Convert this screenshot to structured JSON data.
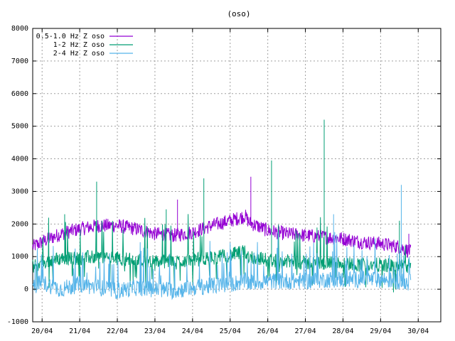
{
  "chart_data": {
    "type": "line",
    "title": "(oso)",
    "xlabel": "",
    "ylabel": "",
    "ylim": [
      -1000,
      8000
    ],
    "yticks": [
      "-1000",
      "0",
      "1000",
      "2000",
      "3000",
      "4000",
      "5000",
      "6000",
      "7000",
      "8000"
    ],
    "xlim": [
      0,
      10.6
    ],
    "xticks": [
      {
        "x": 0,
        "label": "20/04"
      },
      {
        "x": 1,
        "label": "21/04"
      },
      {
        "x": 2,
        "label": "22/04"
      },
      {
        "x": 3,
        "label": "23/04"
      },
      {
        "x": 4,
        "label": "24/04"
      },
      {
        "x": 5,
        "label": "25/04"
      },
      {
        "x": 6,
        "label": "26/04"
      },
      {
        "x": 7,
        "label": "27/04"
      },
      {
        "x": 8,
        "label": "28/04"
      },
      {
        "x": 9,
        "label": "29/04"
      },
      {
        "x": 10,
        "label": "30/04"
      }
    ],
    "grid": true,
    "legend_position": "top-left",
    "series": [
      {
        "name": "0.5-1.0 Hz Z oso",
        "color": "#9400d3",
        "x": [
          -0.25,
          0,
          0.5,
          1,
          1.5,
          2,
          2.5,
          3,
          3.5,
          4,
          4.5,
          5,
          5.4,
          5.5,
          6,
          6.5,
          7,
          7.5,
          8,
          8.5,
          9,
          9.5,
          9.8
        ],
        "y": [
          1300,
          1450,
          1700,
          1850,
          1950,
          1950,
          1850,
          1700,
          1650,
          1750,
          1950,
          2100,
          2250,
          2050,
          1800,
          1700,
          1650,
          1600,
          1550,
          1450,
          1400,
          1300,
          1150
        ],
        "spikes": [
          [
            3.6,
            2750
          ],
          [
            5.55,
            3450
          ],
          [
            9.75,
            1700
          ]
        ]
      },
      {
        "name": "1-2 Hz Z oso",
        "color": "#009e73",
        "x": [
          -0.25,
          0,
          0.5,
          1,
          1.5,
          2,
          2.5,
          3,
          3.5,
          4,
          4.5,
          5,
          5.4,
          5.5,
          6,
          6.5,
          7,
          7.5,
          8,
          8.5,
          9,
          9.5,
          9.8
        ],
        "y": [
          700,
          800,
          950,
          950,
          1000,
          950,
          900,
          850,
          850,
          900,
          950,
          1050,
          1150,
          1000,
          900,
          850,
          800,
          800,
          800,
          750,
          750,
          700,
          700
        ],
        "spikes": [
          [
            0.6,
            2300
          ],
          [
            1.45,
            3300
          ],
          [
            3.3,
            2450
          ],
          [
            4.3,
            3400
          ],
          [
            6.1,
            3950
          ],
          [
            7.5,
            5200
          ],
          [
            9.5,
            2100
          ]
        ]
      },
      {
        "name": "2-4 Hz Z oso",
        "color": "#56b4e9",
        "x": [
          -0.25,
          0,
          0.5,
          1,
          1.5,
          2,
          2.5,
          3,
          3.5,
          4,
          4.5,
          5,
          5.4,
          5.5,
          6,
          6.5,
          7,
          7.5,
          8,
          8.5,
          9,
          9.5,
          9.8
        ],
        "y": [
          100,
          200,
          0,
          150,
          50,
          -50,
          50,
          0,
          -50,
          50,
          100,
          150,
          250,
          200,
          250,
          250,
          250,
          300,
          300,
          300,
          300,
          250,
          200
        ],
        "spikes": [
          [
            7.75,
            2300
          ],
          [
            9.55,
            3200
          ]
        ]
      }
    ]
  }
}
